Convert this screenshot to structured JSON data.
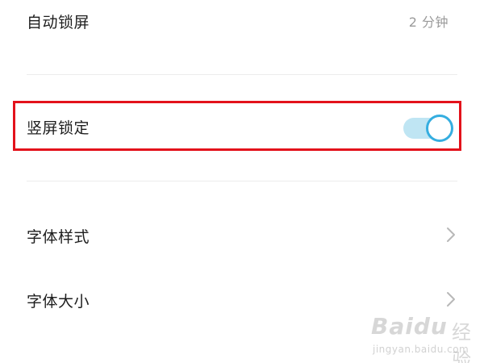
{
  "settings": {
    "auto_lock": {
      "label": "自动锁屏",
      "value": "2 分钟"
    },
    "portrait_lock": {
      "label": "竖屏锁定",
      "enabled": true
    },
    "font_style": {
      "label": "字体样式"
    },
    "font_size": {
      "label": "字体大小"
    }
  },
  "watermark": {
    "logo": "Baidu",
    "sub": "经验",
    "url": "jingyan.baidu.com"
  },
  "colors": {
    "highlight_border": "#e3121b",
    "toggle_accent": "#35aee0",
    "toggle_track": "#bfe5f3"
  },
  "icons": {
    "chevron": "chevron-right-icon"
  }
}
